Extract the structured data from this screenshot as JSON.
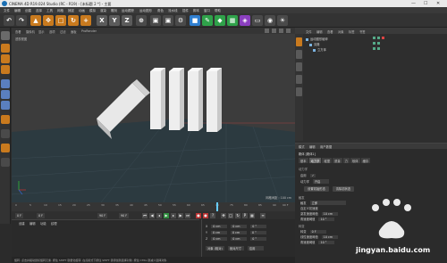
{
  "window": {
    "title": "CINEMA 4D R19.024 Studio (RC - R19) - [未标题 2 *] - 主要",
    "minimize": "—",
    "maximize": "☐",
    "close": "✕"
  },
  "menubar": [
    "文件",
    "编辑",
    "创建",
    "选择",
    "工具",
    "网格",
    "捕捉",
    "动画",
    "模拟",
    "渲染",
    "雕刻",
    "运动跟踪",
    "运动图形",
    "角色",
    "流水线",
    "插件",
    "脚本",
    "窗口",
    "帮助"
  ],
  "viewport": {
    "menu": [
      "查看",
      "摄像机",
      "显示",
      "选项",
      "过滤",
      "面板",
      "ProRender"
    ],
    "label": "透视视图",
    "grid_spacing": "网格间距 : 100 cm"
  },
  "object_manager": {
    "tabs": [
      "文件",
      "编辑",
      "查看",
      "对象",
      "标签",
      "书签"
    ],
    "objects": [
      {
        "name": "运动图形破碎"
      },
      {
        "name": "克隆"
      },
      {
        "name": "立方体"
      }
    ]
  },
  "attributes": {
    "tabs": [
      "模式",
      "编辑",
      "用户数据"
    ],
    "header": "刚体 [刚体1]",
    "subtabs": [
      "基本",
      "动力学",
      "碰撞",
      "质量",
      "力",
      "软体",
      "缓存"
    ],
    "active_subtab": "动力学",
    "section_dyn": "动力学",
    "enabled_label": "启用",
    "dynamic_label": "动力学",
    "dynamic_value": "开启",
    "set_initial": "设置初始形态",
    "clear_initial": "清除初状态",
    "section_trigger": "触发",
    "trigger_label": "触发",
    "trigger_value": "立即",
    "custom_velocity_label": "自定义初速度",
    "velocity_threshold_label": "激发速度阈值",
    "velocity_threshold_value": "10 cm",
    "angular_threshold_label": "角速度阈值",
    "angular_threshold_value": "10 °",
    "section_transition": "转变",
    "transition_label": "转变",
    "transition_value": "0 F",
    "linear_label": "线性速度阈值",
    "linear_value": "10 cm",
    "angular2_label": "角速度阈值",
    "angular2_value": "10 °"
  },
  "timeline": {
    "ticks": [
      "0",
      "5",
      "10",
      "15",
      "20",
      "25",
      "30",
      "35",
      "40",
      "45",
      "50",
      "55",
      "60",
      "65",
      "70",
      "75",
      "80",
      "85",
      "90"
    ],
    "playhead": 0.75,
    "frame_end": "90 F"
  },
  "transport": {
    "start": "0 F",
    "current": "0 F",
    "min": "90 F",
    "max": "90 F"
  },
  "materials": {
    "menu": [
      "创建",
      "编辑",
      "功能",
      "纹理"
    ]
  },
  "coordinates": {
    "rows": [
      {
        "axis": "X",
        "pos": "0 cm",
        "size": "0 cm",
        "rot": "0 °"
      },
      {
        "axis": "Y",
        "pos": "0 cm",
        "size": "0 cm",
        "rot": "0 °"
      },
      {
        "axis": "Z",
        "pos": "0 cm",
        "size": "0 cm",
        "rot": "0 °"
      }
    ],
    "mode": "对象 (相对)",
    "size_mode": "绝对尺寸",
    "apply": "应用"
  },
  "status": "旋转: 点击并拖动鼠标旋转元素. 按住 SHIFT 键量化旋转. 在点模式下按住 SHIFT 键添加到选择对象. 按住 CTRL 键减少选择对象.",
  "watermark": "jingyan.baidu.com",
  "colors": {
    "accent": "#3f7fbf",
    "ground": "#2c3a40"
  }
}
